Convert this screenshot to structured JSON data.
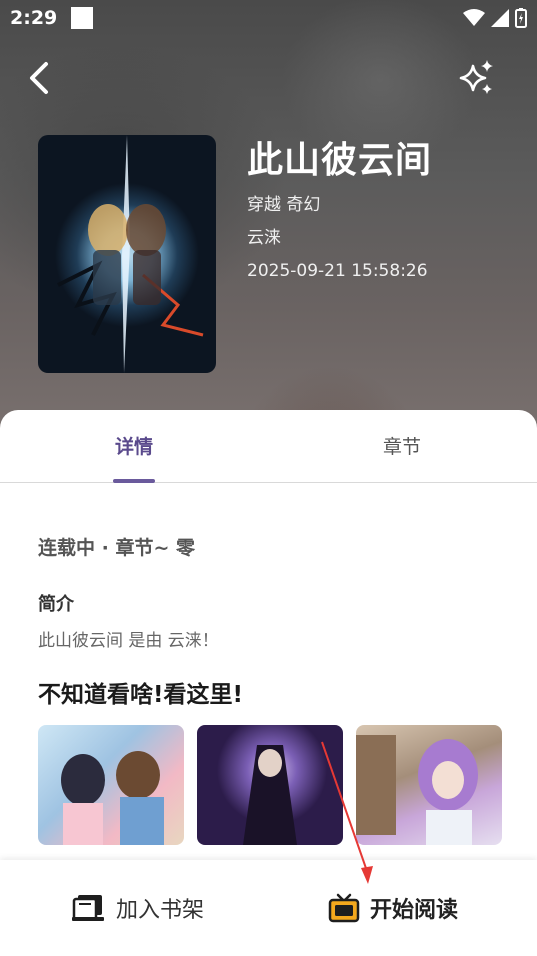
{
  "status_bar": {
    "time": "2:29"
  },
  "book": {
    "title": "此山彼云间",
    "genres": "穿越 奇幻",
    "author": "云涞",
    "updated": "2025-09-21 15:58:26"
  },
  "tabs": [
    {
      "label": "详情",
      "active": true
    },
    {
      "label": "章节",
      "active": false
    }
  ],
  "detail": {
    "status_line": "连载中 · 章节~ 零",
    "intro_title": "简介",
    "intro_text": "此山彼云间 是由 云涞！",
    "recommend_title": "不知道看啥!看这里!"
  },
  "actions": {
    "add_shelf": "加入书架",
    "start_read": "开始阅读"
  },
  "colors": {
    "accent": "#5a4a8c",
    "tv_icon": "#f4a81d"
  }
}
